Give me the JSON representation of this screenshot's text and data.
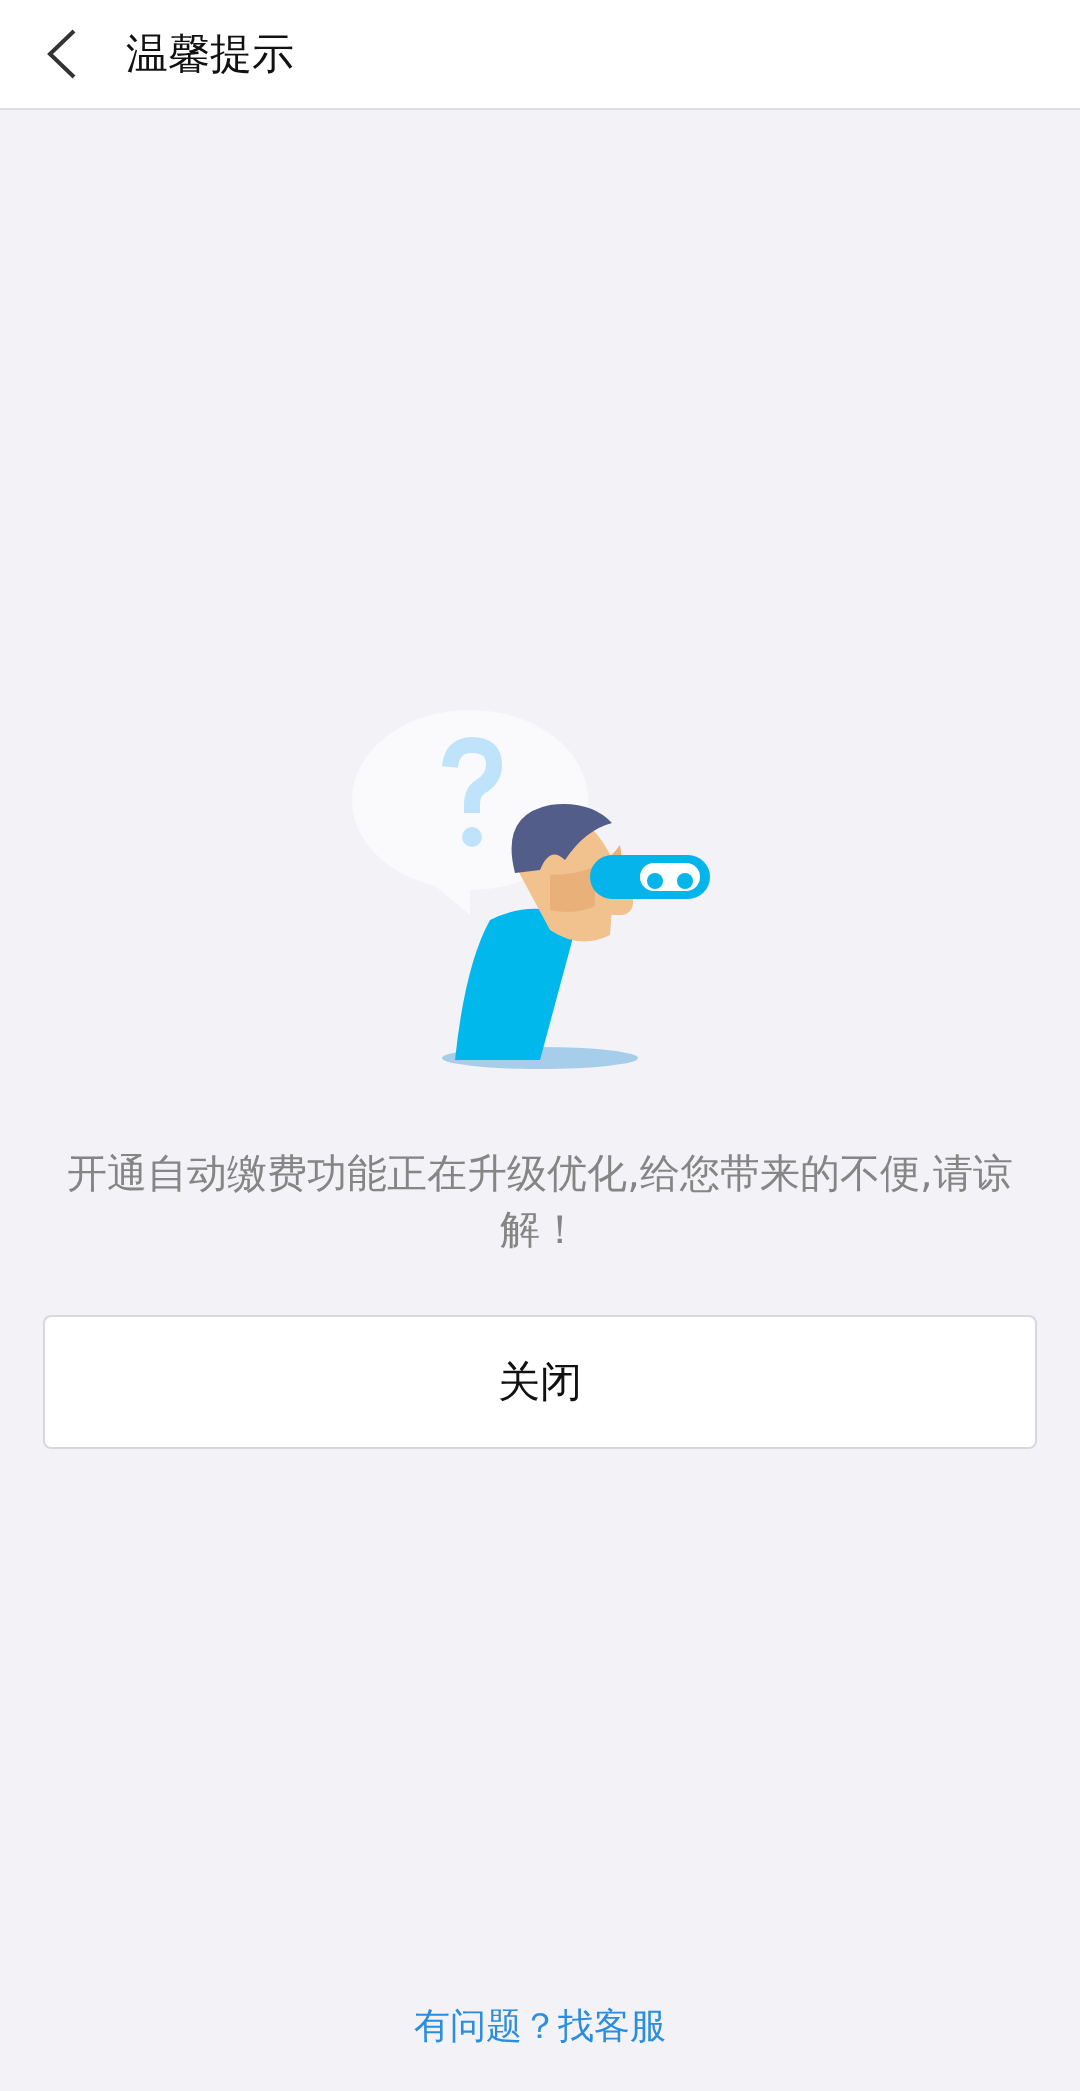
{
  "header": {
    "title": "温馨提示"
  },
  "message": "开通自动缴费功能正在升级优化,给您带来的不便,请谅解！",
  "close_button": {
    "label": "关闭"
  },
  "footer_link": "有问题？找客服"
}
